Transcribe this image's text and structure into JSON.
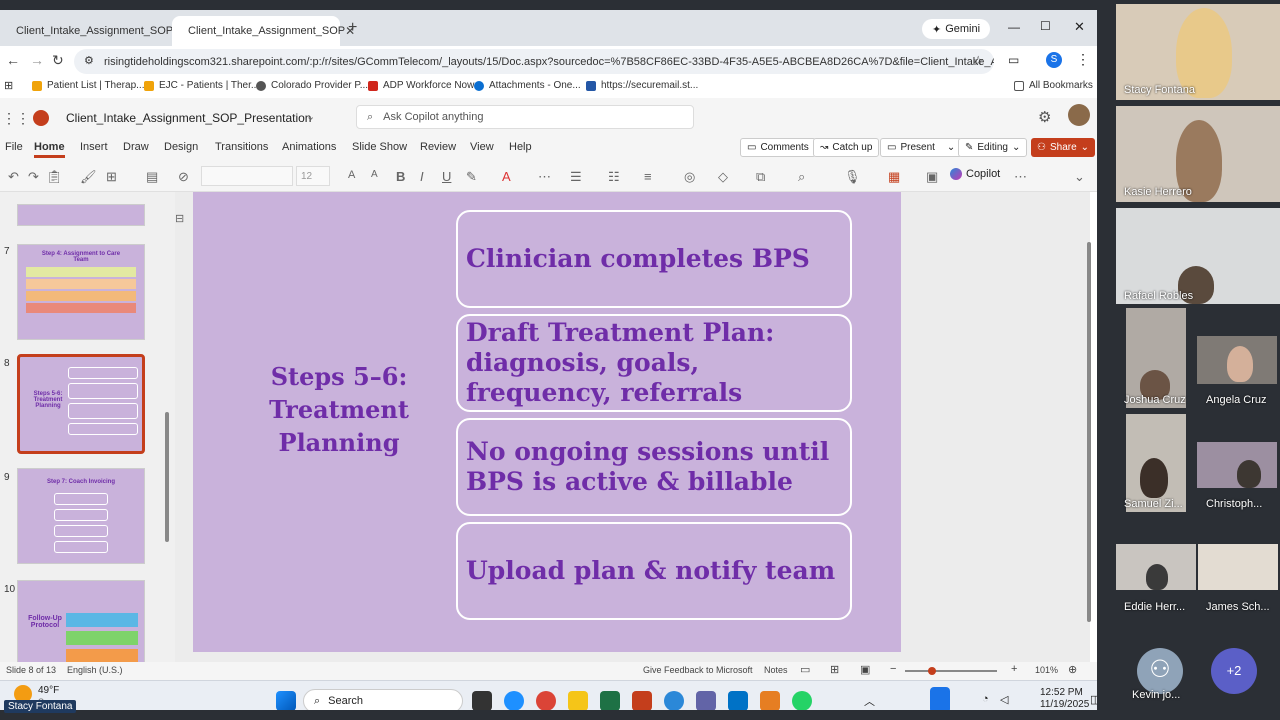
{
  "browser": {
    "tabs": [
      {
        "label": "Client_Intake_Assignment_SOP"
      },
      {
        "label": "Client_Intake_Assignment_SOP"
      }
    ],
    "gemini_label": "Gemini",
    "url": "risingtideholdingscom321.sharepoint.com/:p:/r/sites/GCommTelecom/_layouts/15/Doc.aspx?sourcedoc=%7B58CF86EC-33BD-4F35-A5E5-ABCBEA8D26CA%7D&file=Client_Intake_Assignme...",
    "bookmarks": [
      "Patient List | Therap...",
      "EJC - Patients | Ther...",
      "Colorado Provider P...",
      "ADP Workforce Now",
      "Attachments - One...",
      "https://securemail.st..."
    ],
    "all_bookmarks": "All Bookmarks",
    "profile_initial": "S"
  },
  "ppt": {
    "doc_title": "Client_Intake_Assignment_SOP_Presentation",
    "copilot_search_placeholder": "Ask Copilot anything",
    "menu": [
      "File",
      "Home",
      "Insert",
      "Draw",
      "Design",
      "Transitions",
      "Animations",
      "Slide Show",
      "Review",
      "View",
      "Help"
    ],
    "comments_label": "Comments",
    "catchup_label": "Catch up",
    "present_label": "Present",
    "editing_label": "Editing",
    "share_label": "Share",
    "font_size": "12",
    "copilot_label": "Copilot"
  },
  "thumbnails": [
    {
      "num": "7",
      "title": "Step 4: Assignment to Care Team"
    },
    {
      "num": "8",
      "title": "Steps 5-6: Treatment Planning"
    },
    {
      "num": "9",
      "title": "Step 7: Coach Invoicing"
    },
    {
      "num": "10",
      "title": "Follow-Up Protocol"
    }
  ],
  "slide": {
    "title": "Steps 5–6: Treatment Planning",
    "boxes": [
      "Clinician completes BPS",
      "Draft Treatment Plan: diagnosis, goals, frequency, referrals",
      "No ongoing sessions until BPS is active & billable",
      "Upload plan & notify team"
    ]
  },
  "status": {
    "slide_info": "Slide 8 of 13",
    "language": "English (U.S.)",
    "feedback": "Give Feedback to Microsoft",
    "notes": "Notes",
    "zoom": "101%"
  },
  "taskbar": {
    "weather_temp": "49°F",
    "weather_desc": "Sunny",
    "search_label": "Search",
    "time": "12:52 PM",
    "date": "11/19/2025"
  },
  "participants": [
    "Stacy Fontana",
    "Kasie Herrero",
    "Rafael Robles",
    "Joshua Cruz",
    "Angela Cruz",
    "Samuel Zi...",
    "Christoph...",
    "Eddie Herr...",
    "James Sch...",
    "Kevin jo..."
  ],
  "more_participants": "+2",
  "presenter_label": "Stacy Fontana"
}
